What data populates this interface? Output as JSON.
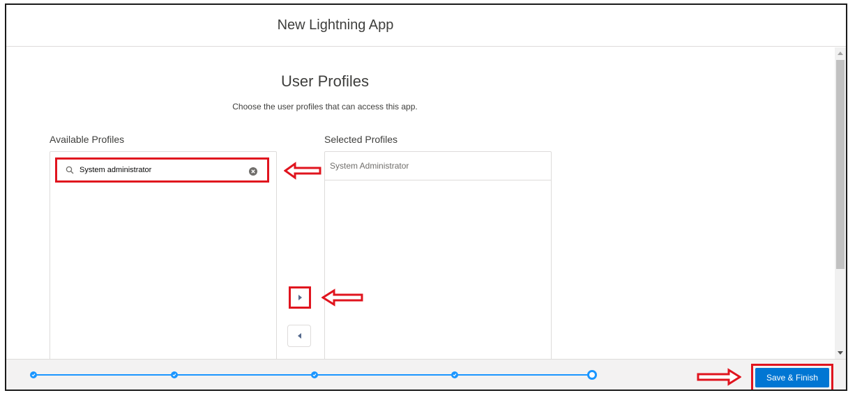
{
  "modal": {
    "title": "New Lightning App"
  },
  "page": {
    "title": "User Profiles",
    "description": "Choose the user profiles that can access this app."
  },
  "available": {
    "label": "Available Profiles",
    "search_value": "System administrator"
  },
  "selected": {
    "label": "Selected Profiles",
    "items": [
      "System Administrator"
    ]
  },
  "footer": {
    "save_label": "Save & Finish",
    "steps_total": 5,
    "current_step": 5
  },
  "colors": {
    "brand": "#0176d3",
    "progress": "#1b96ff",
    "annotation": "#e0141e"
  }
}
